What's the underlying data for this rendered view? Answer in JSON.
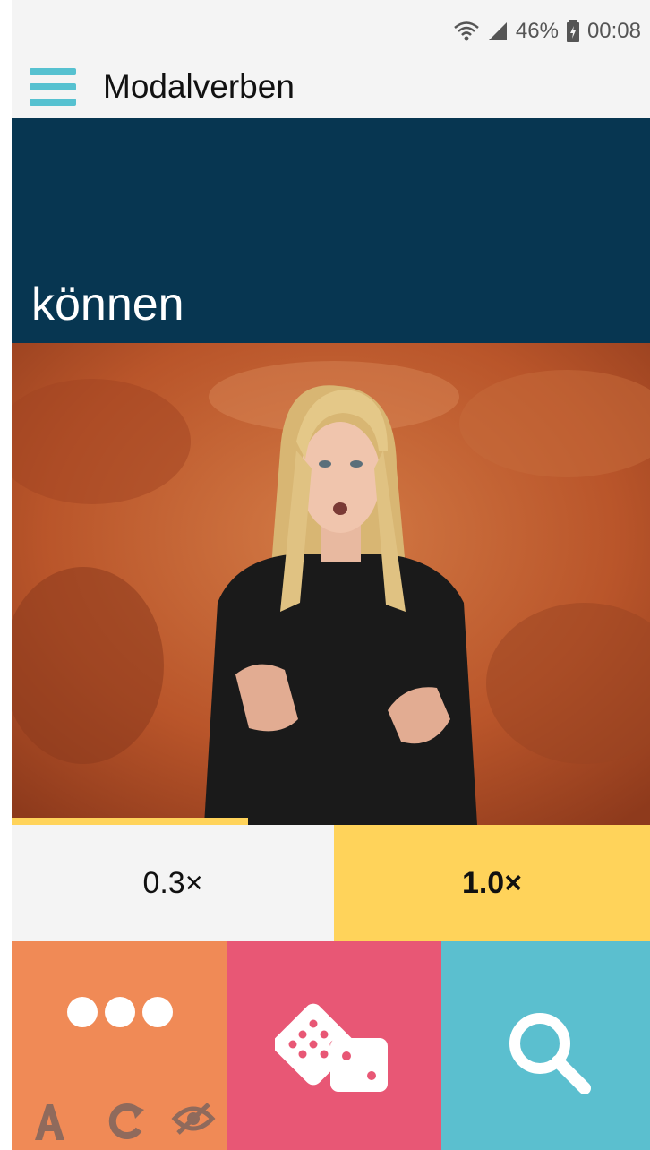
{
  "status_bar": {
    "battery": "46%",
    "time": "00:08",
    "icons": [
      "wifi-icon",
      "signal-icon",
      "battery-icon"
    ]
  },
  "app_bar": {
    "title": "Modalverben",
    "menu_icon": "hamburger-menu-icon"
  },
  "word": {
    "title": "können"
  },
  "video": {
    "progress_fraction": 0.37
  },
  "speed": {
    "slow_label": "0.3×",
    "fast_label": "1.0×",
    "selected": "1.0×"
  },
  "tiles": {
    "more_icon": "more-dots-icon",
    "dice_icon": "dice-icon",
    "search_icon": "search-icon",
    "mini_icons": [
      "font-size-icon",
      "replay-icon",
      "hide-icon"
    ]
  },
  "colors": {
    "accent_teal": "#56c1d0",
    "banner_navy": "#073651",
    "yellow": "#ffd35a",
    "orange": "#f08a56",
    "pink": "#e85775",
    "teal": "#5bbfcf"
  }
}
